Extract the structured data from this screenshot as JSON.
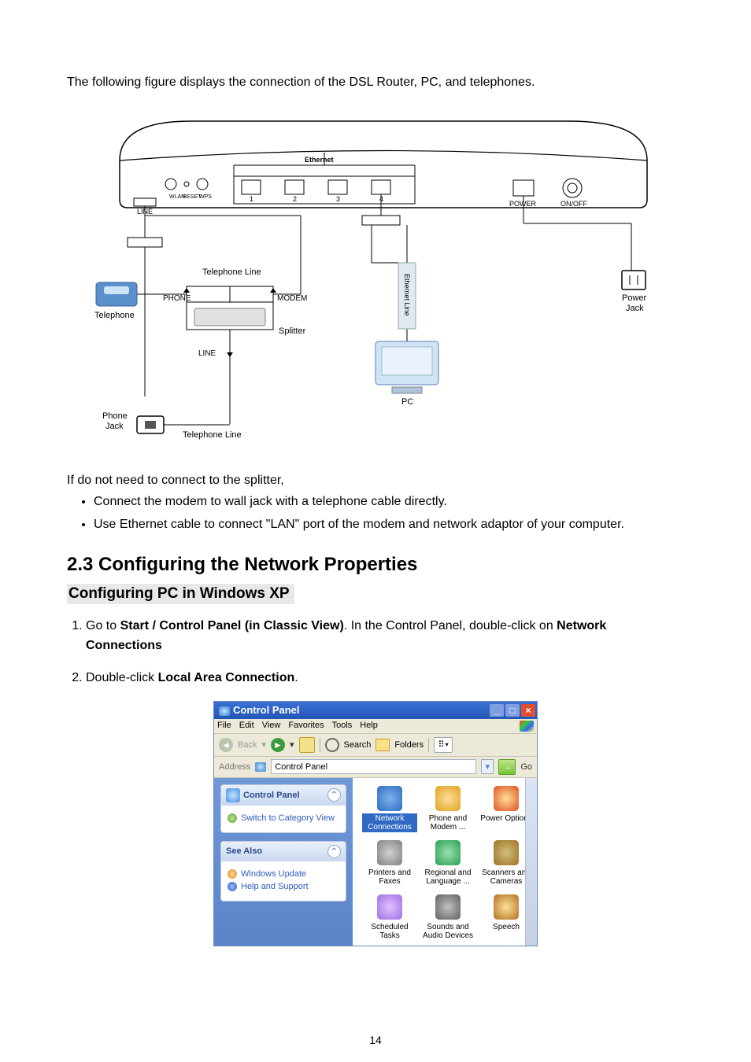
{
  "intro": "The following figure displays the connection of the DSL Router, PC, and telephones.",
  "diagram": {
    "ethernet_header": "Ethernet",
    "port_labels": {
      "line": "LINE",
      "wlan": "WLAN",
      "reset": "RESET",
      "wps": "WPS",
      "power": "POWER",
      "onoff": "ON/OFF"
    },
    "eth_ports": [
      "1",
      "2",
      "3",
      "4"
    ],
    "telephone_line": "Telephone Line",
    "telephone": "Telephone",
    "phone_port": "PHONE",
    "modem_port": "MODEM",
    "splitter": "Splitter",
    "line_port": "LINE",
    "ethernet_line": "Ethernet Line",
    "pc": "PC",
    "power_jack": "Power Jack",
    "phone_jack": "Phone Jack",
    "telephone_line2": "Telephone Line"
  },
  "no_splitter": "If do not need to connect to the splitter,",
  "bullets": [
    "Connect the modem to wall jack with a telephone cable directly.",
    "Use Ethernet cable to connect \"LAN\" port of the modem and network adaptor of your computer."
  ],
  "section_heading": "2.3 Configuring the Network Properties",
  "subsection_heading": "Configuring PC in Windows XP",
  "step1": {
    "pre": "Go to ",
    "b1": "Start / Control Panel (in Classic View)",
    "mid": ". In the Control Panel, double-click on ",
    "b2": "Network Connections"
  },
  "step2": {
    "pre": "Double-click ",
    "b1": "Local Area Connection",
    "post": "."
  },
  "cp": {
    "title": "Control Panel",
    "menus": [
      "File",
      "Edit",
      "View",
      "Favorites",
      "Tools",
      "Help"
    ],
    "toolbar": {
      "back": "Back",
      "search": "Search",
      "folders": "Folders"
    },
    "address_label": "Address",
    "address_value": "Control Panel",
    "go": "Go",
    "card1": {
      "title": "Control Panel",
      "link": "Switch to Category View"
    },
    "card2": {
      "title": "See Also",
      "links": [
        "Windows Update",
        "Help and Support"
      ]
    },
    "items": [
      {
        "label": "Network Connections",
        "sel": true,
        "cls": "i-net"
      },
      {
        "label": "Phone and Modem ...",
        "sel": false,
        "cls": "i-mod"
      },
      {
        "label": "Power Options",
        "sel": false,
        "cls": "i-pow"
      },
      {
        "label": "Printers and Faxes",
        "sel": false,
        "cls": "i-prn"
      },
      {
        "label": "Regional and Language ...",
        "sel": false,
        "cls": "i-reg"
      },
      {
        "label": "Scanners and Cameras",
        "sel": false,
        "cls": "i-scn"
      },
      {
        "label": "Scheduled Tasks",
        "sel": false,
        "cls": "i-sch"
      },
      {
        "label": "Sounds and Audio Devices",
        "sel": false,
        "cls": "i-snd"
      },
      {
        "label": "Speech",
        "sel": false,
        "cls": "i-spc"
      }
    ]
  },
  "page_number": "14"
}
